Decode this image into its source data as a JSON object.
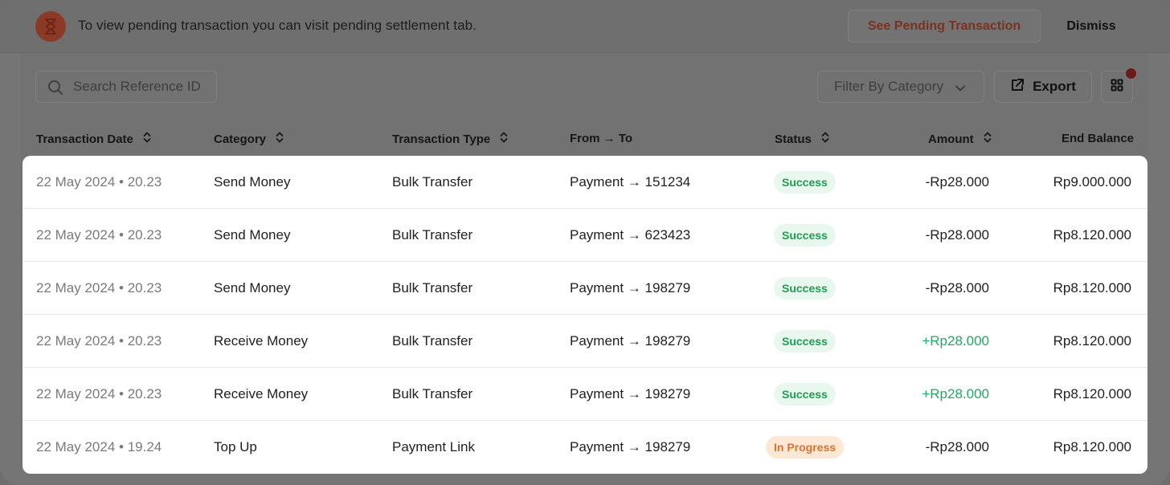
{
  "banner": {
    "message": "To view pending transaction you can visit pending settlement tab.",
    "see_pending_label": "See Pending Transaction",
    "dismiss_label": "Dismiss",
    "icon": "hourglass-icon"
  },
  "toolbar": {
    "search_placeholder": "Search Reference ID",
    "filter_label": "Filter By Category",
    "export_label": "Export"
  },
  "table": {
    "headers": {
      "date": "Transaction Date",
      "category": "Category",
      "type": "Transaction Type",
      "from_to": "From → To",
      "status": "Status",
      "amount": "Amount",
      "end_balance": "End Balance"
    },
    "rows": [
      {
        "date": "22 May 2024 • 20.23",
        "category": "Send Money",
        "type": "Bulk Transfer",
        "from_to": "Payment → 151234",
        "status": "Success",
        "amount": "-Rp28.000",
        "end_balance": "Rp9.000.000"
      },
      {
        "date": "22 May 2024 • 20.23",
        "category": "Send Money",
        "type": "Bulk Transfer",
        "from_to": "Payment → 623423",
        "status": "Success",
        "amount": "-Rp28.000",
        "end_balance": "Rp8.120.000"
      },
      {
        "date": "22 May 2024 • 20.23",
        "category": "Send Money",
        "type": "Bulk Transfer",
        "from_to": "Payment → 198279",
        "status": "Success",
        "amount": "-Rp28.000",
        "end_balance": "Rp8.120.000"
      },
      {
        "date": "22 May 2024 • 20.23",
        "category": "Receive Money",
        "type": "Bulk Transfer",
        "from_to": "Payment → 198279",
        "status": "Success",
        "amount": "+Rp28.000",
        "end_balance": "Rp8.120.000"
      },
      {
        "date": "22 May 2024 • 20.23",
        "category": "Receive Money",
        "type": "Bulk Transfer",
        "from_to": "Payment → 198279",
        "status": "Success",
        "amount": "+Rp28.000",
        "end_balance": "Rp8.120.000"
      },
      {
        "date": "22 May 2024 • 19.24",
        "category": "Top Up",
        "type": "Payment Link",
        "from_to": "Payment → 198279",
        "status": "In Progress",
        "amount": "-Rp28.000",
        "end_balance": "Rp8.120.000"
      }
    ]
  },
  "colors": {
    "success_text": "#1f9d50",
    "success_bg": "#e9f8ee",
    "progress_text": "#e0702c",
    "progress_bg": "#fde8d6",
    "positive_amount": "#21a865",
    "brand_orange": "#e0582e"
  }
}
